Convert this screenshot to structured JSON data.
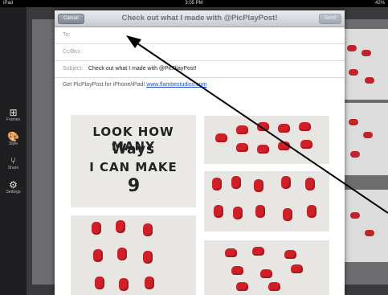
{
  "status_bar": {
    "carrier": "iPad",
    "time": "3:05 PM",
    "battery": "42%"
  },
  "toolbar": {
    "items": [
      {
        "label": "Frames",
        "icon": "frames-icon",
        "glyph": "⊞"
      },
      {
        "label": "Style",
        "icon": "palette-icon",
        "glyph": "🎨"
      },
      {
        "label": "Share",
        "icon": "share-icon",
        "glyph": "⑂"
      },
      {
        "label": "Settings",
        "icon": "gear-icon",
        "glyph": "⚙"
      }
    ]
  },
  "compose": {
    "cancel_label": "Cancel",
    "title": "Check out what I made with @PicPlayPost!",
    "send_label": "Send",
    "to_label": "To:",
    "to_value": "",
    "ccbcc_label": "Cc/Bcc:",
    "subject_label": "Subject:",
    "subject_value": "Check out what I made with @PicPlayPost!",
    "body_text": "Get PicPlayPost for iPhone/iPad!",
    "body_link": "www.flambestudios.com"
  },
  "collage_text": {
    "line1": "LOOK HOW MANY",
    "line2": "Ways",
    "line3": "I CAN MAKE",
    "line4": "9"
  },
  "colors": {
    "accent": "#1a4fc9",
    "bear": "#cf1f27",
    "header": "#c6cad0"
  }
}
